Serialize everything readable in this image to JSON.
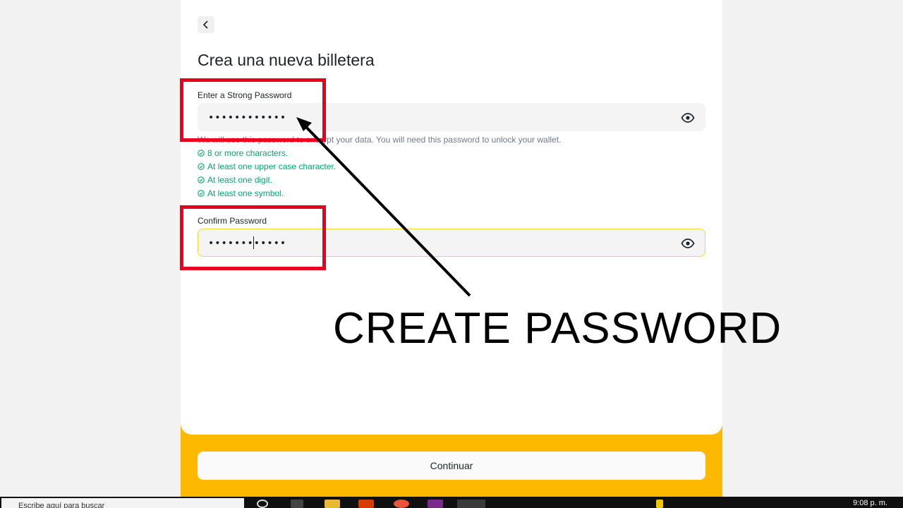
{
  "app": {
    "title": "Crea una nueva billetera"
  },
  "password_field": {
    "label": "Enter a Strong Password",
    "value": "••••••••••••",
    "hint": "We will use this password to encrypt your data. You will need this password to unlock your wallet."
  },
  "rules": [
    {
      "text": "8 or more characters.",
      "met": true
    },
    {
      "text": "At least one upper case character.",
      "met": true
    },
    {
      "text": "At least one digit.",
      "met": true
    },
    {
      "text": "At least one symbol.",
      "met": true
    }
  ],
  "confirm_field": {
    "label": "Confirm Password",
    "value": "••••••••••••"
  },
  "footer": {
    "continue_label": "Continuar"
  },
  "annotation": {
    "text": "CREATE PASSWORD"
  },
  "taskbar": {
    "search_placeholder": "Escribe aquí para buscar",
    "time": "9:08 p. m."
  },
  "colors": {
    "accent": "#fcb900",
    "success": "#03a66d",
    "annotation_box": "#e8001c",
    "focus_border": "#fcd535"
  },
  "icons": {
    "back": "chevron-left-icon",
    "visibility": "eye-icon",
    "rule_check": "check-circle-icon"
  }
}
